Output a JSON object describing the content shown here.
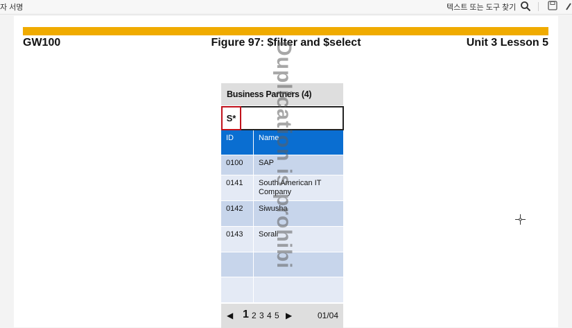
{
  "toolbar": {
    "signature_label": "자 서명",
    "find_label": "텍스트 또는 도구 찾기",
    "icons": [
      "search-icon",
      "save-icon",
      "edit-icon"
    ]
  },
  "slide": {
    "course": "GW100",
    "title": "Figure 97: $filter and $select",
    "unit": "Unit 3 Lesson 5",
    "accent_color": "#f0ab00"
  },
  "mockup": {
    "title": "Business Partners (4)",
    "search_value": "S*",
    "columns": [
      "ID",
      "Name"
    ],
    "rows": [
      {
        "id": "0100",
        "name": "SAP"
      },
      {
        "id": "0141",
        "name": "South American IT Company"
      },
      {
        "id": "0142",
        "name": "Siwusha"
      },
      {
        "id": "0143",
        "name": "Sorali"
      },
      {
        "id": "",
        "name": ""
      },
      {
        "id": "",
        "name": ""
      }
    ],
    "pagination": {
      "prev": "◀",
      "current": "1",
      "pages": "2 3 4 5",
      "next": "▶",
      "counter": "01/04"
    },
    "header_color": "#0a6ed1",
    "highlight_color": "#c0111b"
  },
  "watermark": "Duplication is prohibi"
}
